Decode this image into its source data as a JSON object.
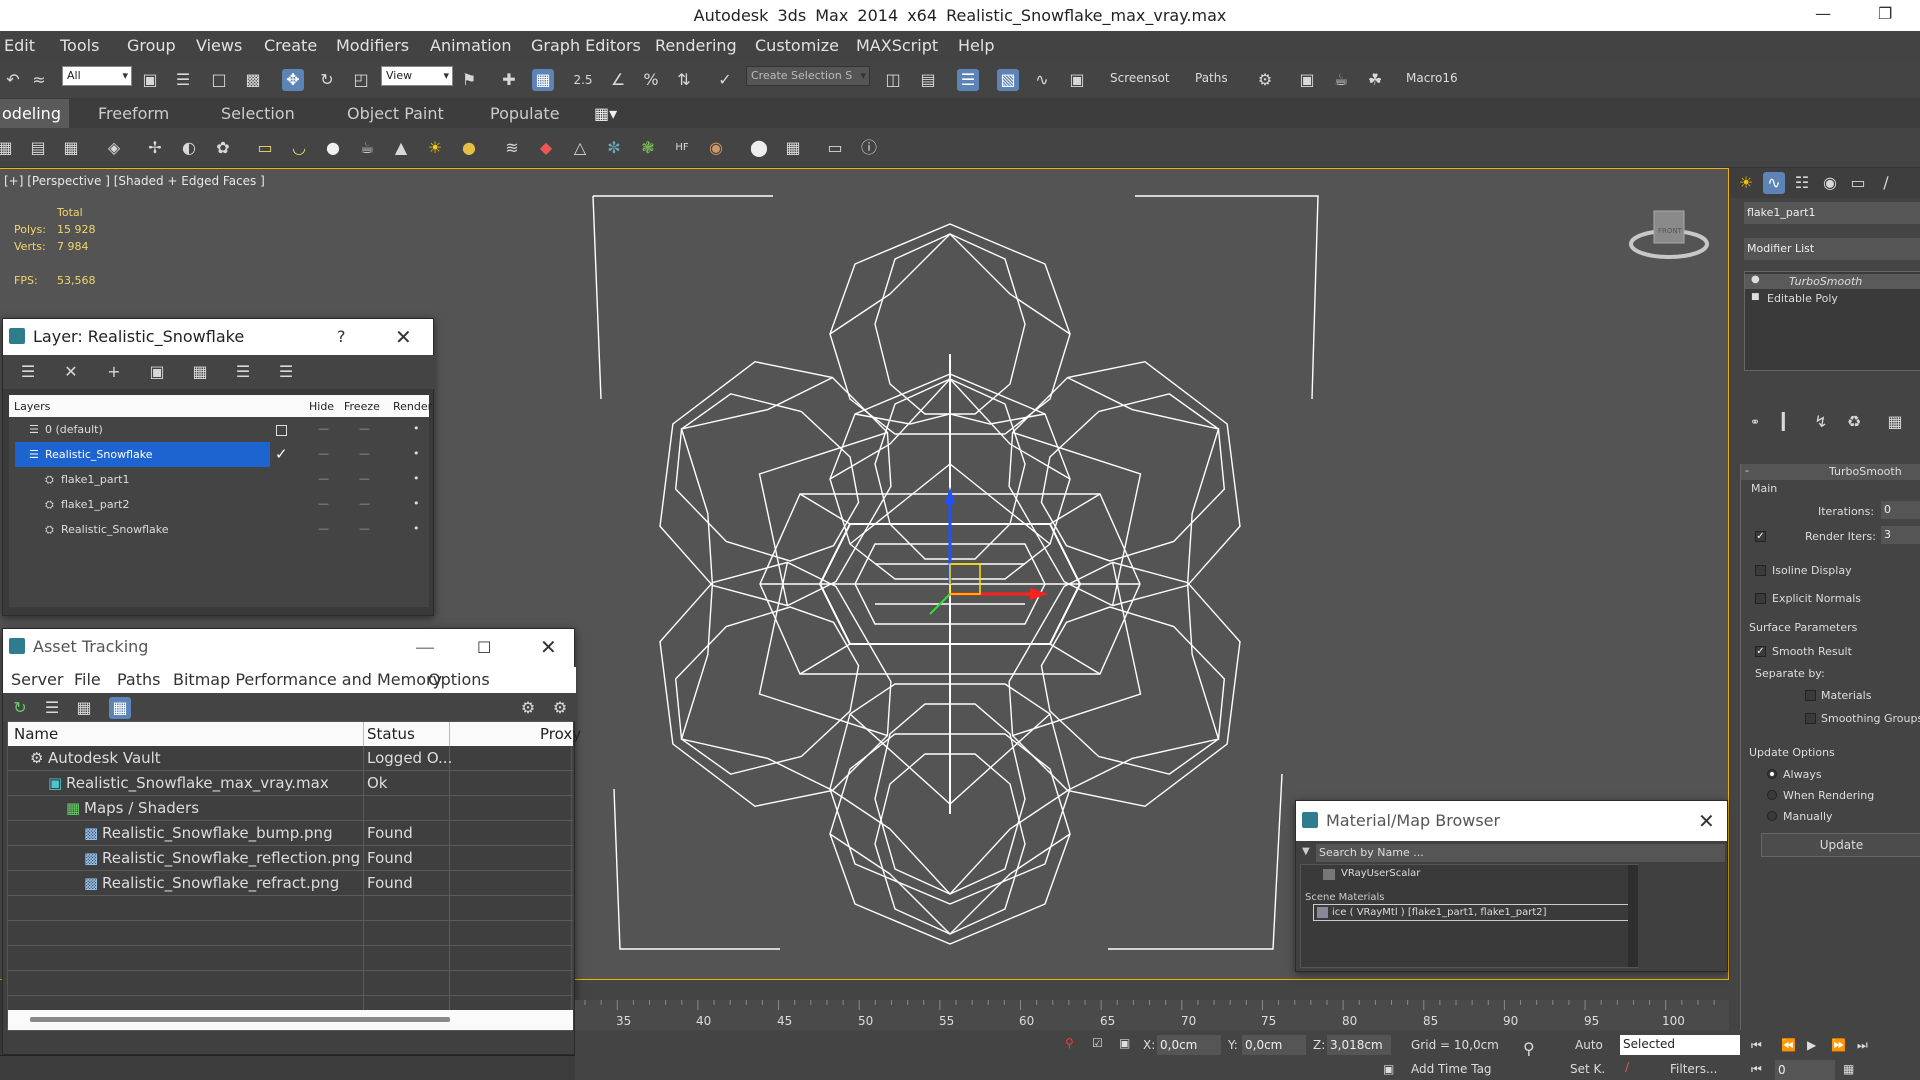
{
  "window": {
    "title": "Autodesk 3ds Max  2014 x64      Realistic_Snowflake_max_vray.max"
  },
  "menu": [
    "Edit",
    "Tools",
    "Group",
    "Views",
    "Create",
    "Modifiers",
    "Animation",
    "Graph Editors",
    "Rendering",
    "Customize",
    "MAXScript",
    "Help"
  ],
  "toolbar": {
    "filter_value": "All",
    "refcoord_value": "View",
    "selection_set_placeholder": "Create Selection S",
    "screenshot_label": "Screensot",
    "paths_label": "Paths",
    "macro_label": "Macro16",
    "snap_label": "2.5"
  },
  "ribbon": {
    "tabs": [
      "odeling",
      "Freeform",
      "Selection",
      "Object Paint",
      "Populate"
    ]
  },
  "viewport": {
    "label": "[+] [Perspective ] [Shaded + Edged Faces ]",
    "stats": {
      "total_label": "Total",
      "polys_label": "Polys:",
      "polys_value": "15 928",
      "verts_label": "Verts:",
      "verts_value": "7 984",
      "fps_label": "FPS:",
      "fps_value": "53,568"
    }
  },
  "layer_panel": {
    "title": "Layer: Realistic_Snowflake",
    "help": "?",
    "headers": {
      "layers": "Layers",
      "hide": "Hide",
      "freeze": "Freeze",
      "render": "Render"
    },
    "rows": [
      {
        "label": "0 (default)",
        "hide": "—",
        "freeze": "—",
        "render": "•"
      },
      {
        "label": "Realistic_Snowflake",
        "hide": "—",
        "freeze": "—",
        "render": "•"
      },
      {
        "label": "flake1_part1",
        "hide": "—",
        "freeze": "—",
        "render": "•"
      },
      {
        "label": "flake1_part2",
        "hide": "—",
        "freeze": "—",
        "render": "•"
      },
      {
        "label": "Realistic_Snowflake",
        "hide": "—",
        "freeze": "—",
        "render": "•"
      }
    ]
  },
  "asset_panel": {
    "title": "Asset Tracking",
    "menu": [
      "Server",
      "File",
      "Paths",
      "Bitmap Performance and Memory",
      "Options"
    ],
    "headers": {
      "name": "Name",
      "status": "Status",
      "proxy": "Proxy"
    },
    "rows": [
      {
        "name": "Autodesk Vault",
        "status": "Logged O..."
      },
      {
        "name": "Realistic_Snowflake_max_vray.max",
        "status": "Ok"
      },
      {
        "name": "Maps / Shaders",
        "status": ""
      },
      {
        "name": "Realistic_Snowflake_bump.png",
        "status": "Found"
      },
      {
        "name": "Realistic_Snowflake_reflection.png",
        "status": "Found"
      },
      {
        "name": "Realistic_Snowflake_refract.png",
        "status": "Found"
      }
    ]
  },
  "material_browser": {
    "title": "Material/Map Browser",
    "search_placeholder": "Search by Name ...",
    "item": "VRayUserScalar",
    "section": "Scene Materials",
    "material": "ice ( VRayMtl ) [flake1_part1, flake1_part2]"
  },
  "command_panel": {
    "object_name": "flake1_part1",
    "modifier_list": "Modifier List",
    "stack": [
      "TurboSmooth",
      "Editable Poly"
    ],
    "rollout_title": "TurboSmooth",
    "main_label": "Main",
    "iterations_label": "Iterations:",
    "iterations_value": "0",
    "render_iters_label": "Render Iters:",
    "render_iters_value": "3",
    "isoline": "Isoline Display",
    "explicit": "Explicit Normals",
    "surface_label": "Surface Parameters",
    "smooth_result": "Smooth Result",
    "separate_by": "Separate by:",
    "materials": "Materials",
    "smoothing_groups": "Smoothing Groups",
    "update_label": "Update Options",
    "always": "Always",
    "when_rendering": "When Rendering",
    "manually": "Manually",
    "update_button": "Update",
    "viewcube_label": "FRONT"
  },
  "timeline": {
    "ticks": [
      "35",
      "40",
      "45",
      "50",
      "55",
      "60",
      "65",
      "70",
      "75",
      "80",
      "85",
      "90",
      "95",
      "100"
    ]
  },
  "status": {
    "x_label": "X:",
    "x_value": "0,0cm",
    "y_label": "Y:",
    "y_value": "0,0cm",
    "z_label": "Z:",
    "z_value": "3,018cm",
    "grid": "Grid = 10,0cm",
    "auto": "Auto",
    "setk": "Set K.",
    "selected": "Selected",
    "filters": "Filters...",
    "add_time_tag": "Add Time Tag",
    "frame": "0"
  }
}
